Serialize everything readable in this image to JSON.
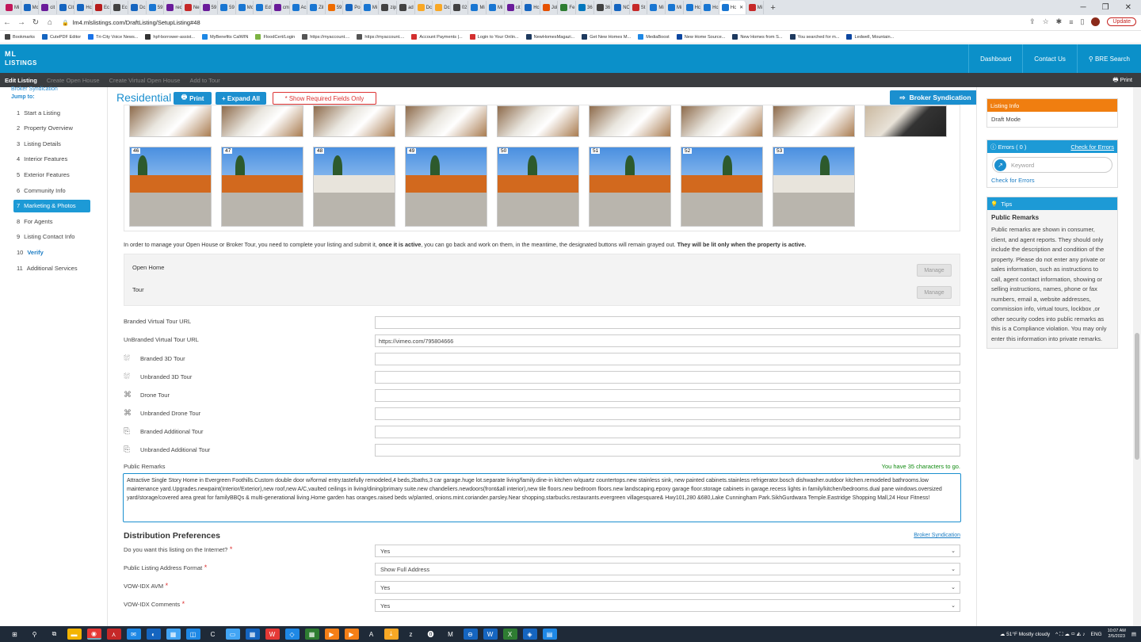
{
  "browser": {
    "tabs": [
      "Mi",
      "Mc",
      "cit",
      "Cit",
      "Hc",
      "Ec",
      "Ec",
      "Dc",
      "59",
      "rec",
      "Ne",
      "59",
      "59",
      "Mc",
      "Ed",
      "cm",
      "Ac",
      "Zil",
      "59",
      "Po",
      "Mi",
      "zip",
      "ad",
      "Dc",
      "Dc",
      "02",
      "Mi",
      "Mi",
      "cit",
      "Hc",
      "Jol",
      "Fe",
      "36",
      "36",
      "NC",
      "St",
      "Mi",
      "Mi",
      "Hc",
      "Hc",
      "Hc",
      "Mi"
    ],
    "tab_colors": [
      "#c2185b",
      "#1565c0",
      "#6a1b9a",
      "#1565c0",
      "#1565c0",
      "#b71c1c",
      "#424242",
      "#1565c0",
      "#1976d2",
      "#6a1b9a",
      "#c62828",
      "#6a1b9a",
      "#1976d2",
      "#1976d2",
      "#1976d2",
      "#6a1b9a",
      "#1976d2",
      "#1976d2",
      "#ef6c00",
      "#1565c0",
      "#1976d2",
      "#424242",
      "#424242",
      "#f9a825",
      "#f9a825",
      "#424242",
      "#1976d2",
      "#1976d2",
      "#6a1b9a",
      "#1565c0",
      "#e65100",
      "#2e7d32",
      "#0277bd",
      "#424242",
      "#1565c0",
      "#c62828",
      "#1976d2",
      "#1976d2",
      "#1976d2",
      "#1976d2",
      "#1976d2",
      "#c62828"
    ],
    "url": "lm4.mlslistings.com/DraftListing/SetupListing#48",
    "update_label": "Update",
    "bookmarks": [
      "Bookmarks",
      "CutePDF Editor",
      "Tri-City Voice News...",
      "hpf-borrower-assist...",
      "MyBenefits CalWIN",
      "FloodCert/Login",
      "https://myaccount....",
      "https://myaccount....",
      "Account Payments |...",
      "Login to Your Onlin...",
      "NewHomesMagazi...",
      "Get New Homes M...",
      "MediaBoost",
      "New Home Source...",
      "New Homes from S...",
      "You searched for m...",
      "Ledwell, Mountain..."
    ]
  },
  "header": {
    "logo_top": "ML",
    "logo_bottom": "LISTINGS",
    "nav": [
      "Dashboard",
      "Contact Us",
      "BRE Search"
    ]
  },
  "subnav": {
    "items": [
      "Edit Listing",
      "Create Open House",
      "Create Virtual Open House",
      "Add to Tour"
    ],
    "print": "Print"
  },
  "sidebar": {
    "broker": "Broker Syndication",
    "jump": "Jump to:",
    "items": [
      {
        "n": "1",
        "label": "Start a Listing"
      },
      {
        "n": "2",
        "label": "Property Overview"
      },
      {
        "n": "3",
        "label": "Listing Details"
      },
      {
        "n": "4",
        "label": "Interior Features"
      },
      {
        "n": "5",
        "label": "Exterior Features"
      },
      {
        "n": "6",
        "label": "Community Info"
      },
      {
        "n": "7",
        "label": "Marketing & Photos"
      },
      {
        "n": "8",
        "label": "For Agents"
      },
      {
        "n": "9",
        "label": "Listing Contact Info"
      },
      {
        "n": "10",
        "label": "Verify"
      },
      {
        "n": "11",
        "label": "Additional Services"
      }
    ]
  },
  "main": {
    "title": "Residential",
    "print_btn": "Print",
    "expand_btn": "+ Expand All",
    "required_btn": "* Show Required Fields Only",
    "broker_btn": "Broker Syndication",
    "photo_numbers": [
      "46",
      "47",
      "48",
      "49",
      "50",
      "51",
      "52",
      "53"
    ],
    "note_pre": "In order to manage your Open House or Broker Tour, you need to complete your listing and submit it, ",
    "note_bold1": "once it is active",
    "note_mid": ", you can go back and work on them, in the meantime, the designated buttons will remain grayed out. ",
    "note_bold2": "They will be lit only when the property is active.",
    "open_home": "Open Home",
    "tour": "Tour",
    "manage": "Manage",
    "fields": [
      {
        "label": "Branded Virtual Tour URL",
        "value": ""
      },
      {
        "label": "UnBranded Virtual Tour URL",
        "value": "https://vimeo.com/795804666"
      },
      {
        "label": "Branded 3D Tour",
        "value": ""
      },
      {
        "label": "Unbranded 3D Tour",
        "value": ""
      },
      {
        "label": "Drone Tour",
        "value": ""
      },
      {
        "label": "Unbranded Drone Tour",
        "value": ""
      },
      {
        "label": "Branded Additional Tour",
        "value": ""
      },
      {
        "label": "Unbranded Additional Tour",
        "value": ""
      }
    ],
    "public_remarks_label": "Public Remarks",
    "chars_left": "You have 35 characters to go.",
    "public_remarks": "Attractive Single Story Home in Evergreen Foothills.Custom double door w/formal entry.tastefully remodeled,4 beds,2baths,3 car garage.huge lot.separate living/family.dine-in kitchen w/quartz countertops.new stainless sink, new painted cabinets.stainless refrigerator.bosch dishwasher.outdoor kitchen.remodeled bathrooms.low maintenance yard.Upgrades.newpaint(Interior/Exterior),new roof,new A/C,vaulted ceilings in living/dining/primary suite.new chandeliers.newdoors(front&all interior),new tile floors.new bedroom floors.new landscaping.epoxy garage floor.storage cabinets in garage.recess lights in family/kitchen/bedrooms.dual pane windows.oversized yard/storage/covered area great for familyBBQs & multi-generational living.Home garden has oranges.raised beds w/planted, onions.mint.coriander.parsley.Near shopping.starbucks.restaurants.evergreen villagesquare& Hwy101,280 &680,Lake Cunningham Park.SikhGurdwara Temple.Eastridge Shopping Mall,24 Hour Fitness!",
    "dist_title": "Distribution Preferences",
    "dist_link": "Broker Syndication",
    "dist_fields": [
      {
        "label": "Do you want this listing on the Internet?",
        "value": "Yes"
      },
      {
        "label": "Public Listing Address Format",
        "value": "Show Full Address"
      },
      {
        "label": "VOW-IDX AVM",
        "value": "Yes"
      },
      {
        "label": "VOW-IDX Comments",
        "value": "Yes"
      }
    ]
  },
  "right": {
    "listing_info": "Listing Info",
    "draft": "Draft Mode",
    "errors": "Errors ( 0 )",
    "check_errors_link": "Check for Errors",
    "keyword_placeholder": "Keyword",
    "check_errors": "Check for Errors",
    "tips": "Tips",
    "tips_title": "Public Remarks",
    "tips_text": "Public remarks are shown in consumer, client, and agent reports. They should only include the description and condition of the property. Please do not enter any private or sales information, such as instructions to call, agent contact information, showing or selling instructions, names, phone or fax numbers, email a, website addresses, commission info, virtual tours, lockbox ,or other security codes into public remarks as this is a Compliance violation. You may only enter this information into private remarks."
  },
  "taskbar": {
    "weather": "51°F  Mostly cloudy",
    "lang": "ENG",
    "time": "10:07 AM",
    "date": "2/5/2023"
  }
}
